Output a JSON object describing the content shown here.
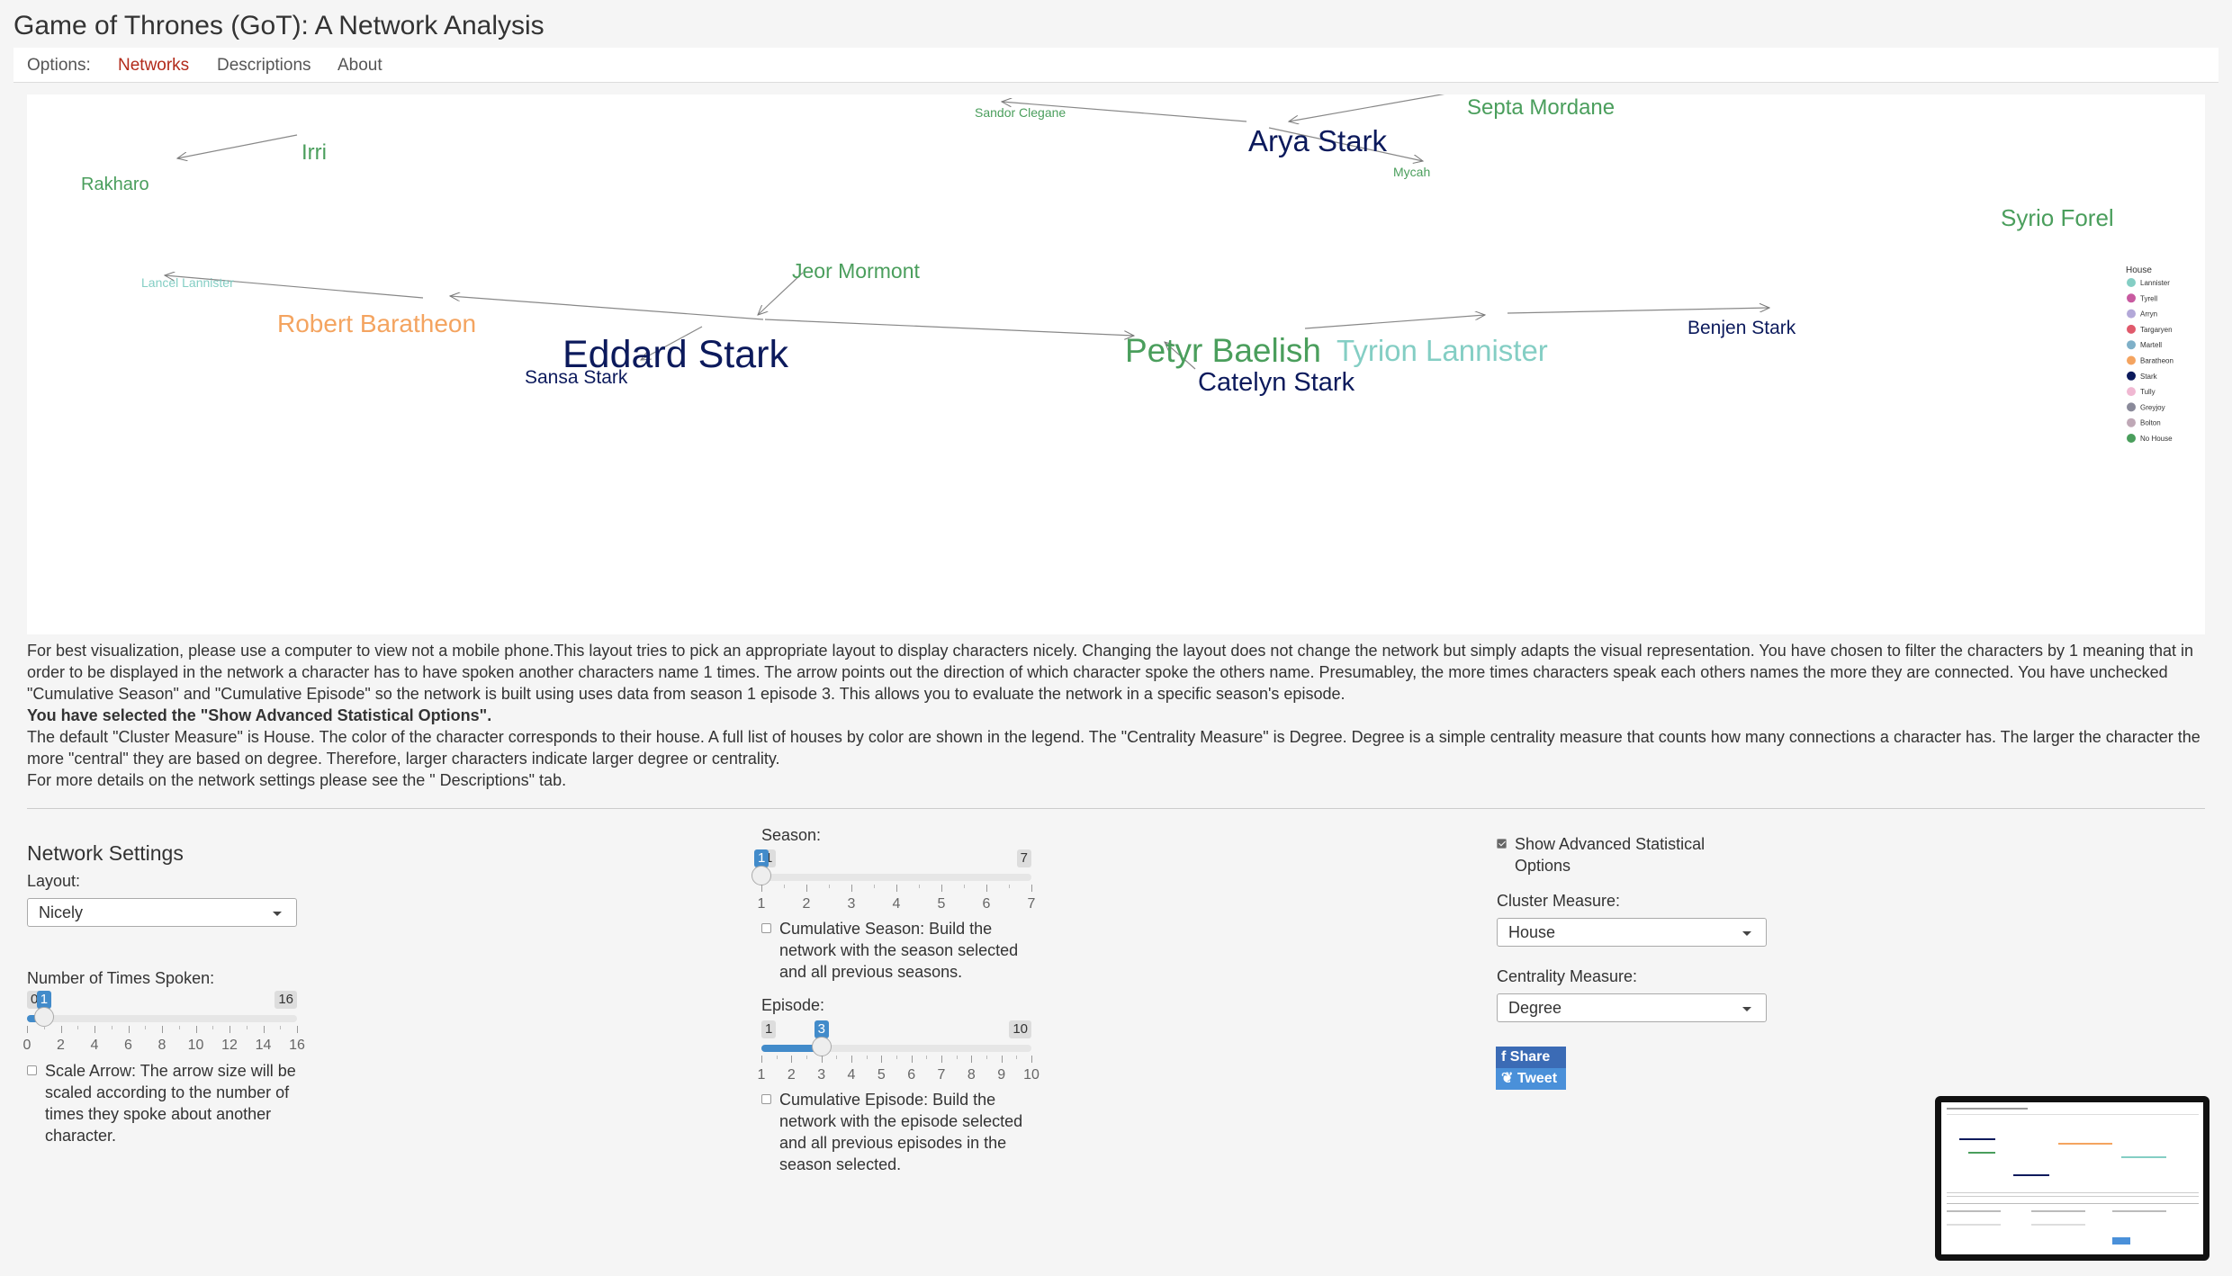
{
  "app": {
    "title": "Game of Thrones (GoT): A Network Analysis"
  },
  "nav": {
    "items": [
      "Options:",
      "Networks",
      "Descriptions",
      "About"
    ],
    "active": "Networks"
  },
  "network": {
    "legend": {
      "title": "House",
      "items": [
        {
          "label": "Lannister",
          "color": "#84cec4"
        },
        {
          "label": "Tyrell",
          "color": "#c85aa0"
        },
        {
          "label": "Arryn",
          "color": "#b3a8d8"
        },
        {
          "label": "Targaryen",
          "color": "#e05a6c"
        },
        {
          "label": "Martell",
          "color": "#7fb0c8"
        },
        {
          "label": "Baratheon",
          "color": "#f4a460"
        },
        {
          "label": "Stark",
          "color": "#0c1a5c"
        },
        {
          "label": "Tully",
          "color": "#f0b8d2"
        },
        {
          "label": "Greyjoy",
          "color": "#8a8a9a"
        },
        {
          "label": "Bolton",
          "color": "#bfa8b6"
        },
        {
          "label": "No House",
          "color": "#4a9e5c"
        }
      ]
    },
    "nodes": [
      {
        "id": "irri",
        "label": "Irri",
        "house": "No House",
        "color": "#4a9e5c"
      },
      {
        "id": "rakharo",
        "label": "Rakharo",
        "house": "No House",
        "color": "#4a9e5c"
      },
      {
        "id": "sandor",
        "label": "Sandor Clegane",
        "house": "No House",
        "color": "#4a9e5c"
      },
      {
        "id": "arya",
        "label": "Arya Stark",
        "house": "Stark",
        "color": "#0c1a5c"
      },
      {
        "id": "septa",
        "label": "Septa Mordane",
        "house": "No House",
        "color": "#4a9e5c"
      },
      {
        "id": "mycah",
        "label": "Mycah",
        "house": "No House",
        "color": "#4a9e5c"
      },
      {
        "id": "syrio",
        "label": "Syrio Forel",
        "house": "No House",
        "color": "#4a9e5c"
      },
      {
        "id": "lancel",
        "label": "Lancel Lannister",
        "house": "Lannister",
        "color": "#84cec4"
      },
      {
        "id": "jeor",
        "label": "Jeor Mormont",
        "house": "No House",
        "color": "#4a9e5c"
      },
      {
        "id": "robert",
        "label": "Robert Baratheon",
        "house": "Baratheon",
        "color": "#f4a460"
      },
      {
        "id": "eddard",
        "label": "Eddard Stark",
        "house": "Stark",
        "color": "#0c1a5c"
      },
      {
        "id": "sansa",
        "label": "Sansa Stark",
        "house": "Stark",
        "color": "#0c1a5c"
      },
      {
        "id": "petyr",
        "label": "Petyr Baelish",
        "house": "No House",
        "color": "#4a9e5c"
      },
      {
        "id": "tyrion",
        "label": "Tyrion Lannister",
        "house": "Lannister",
        "color": "#84cec4"
      },
      {
        "id": "benjen",
        "label": "Benjen Stark",
        "house": "Stark",
        "color": "#0c1a5c"
      },
      {
        "id": "catelyn",
        "label": "Catelyn Stark",
        "house": "Stark",
        "color": "#0c1a5c"
      }
    ],
    "edges": [
      {
        "from": "irri",
        "to": "rakharo"
      },
      {
        "from": "arya",
        "to": "sandor"
      },
      {
        "from": "septa",
        "to": "arya"
      },
      {
        "from": "arya",
        "to": "mycah"
      },
      {
        "from": "robert",
        "to": "lancel"
      },
      {
        "from": "jeor",
        "to": "eddard"
      },
      {
        "from": "eddard",
        "to": "robert"
      },
      {
        "from": "eddard",
        "to": "sansa"
      },
      {
        "from": "eddard",
        "to": "petyr"
      },
      {
        "from": "catelyn",
        "to": "petyr"
      },
      {
        "from": "petyr",
        "to": "tyrion"
      },
      {
        "from": "tyrion",
        "to": "benjen"
      }
    ]
  },
  "description": {
    "p1": "For best visualization, please use a computer to view not a mobile phone.This layout tries to pick an appropriate layout to display characters nicely. Changing the layout does not change the network but simply adapts the visual representation. You have chosen to filter the characters by 1 meaning that in order to be displayed in the network a character has to have spoken another characters name 1 times. The arrow points out the direction of which character spoke the others name. Presumabley, the more times characters speak each others names the more they are connected. You have unchecked \"Cumulative Season\" and \"Cumulative Episode\" so the network is built using uses data from season 1 episode 3. This allows you to evaluate the network in a specific season's episode.",
    "p2": "You have selected the \"Show Advanced Statistical Options\".",
    "p3": "The default \"Cluster Measure\" is House. The color of the character corresponds to their house. A full list of houses by color are shown in the legend. The \"Centrality Measure\" is Degree. Degree is a simple centrality measure that counts how many connections a character has. The larger the character the more \"central\" they are based on degree. Therefore, larger characters indicate larger degree or centrality.",
    "p4": "For more details on the network settings please see the \" Descriptions\" tab."
  },
  "settings": {
    "title": "Network Settings",
    "layout": {
      "label": "Layout:",
      "value": "Nicely"
    },
    "times_spoken": {
      "label": "Number of Times Spoken:",
      "min": 0,
      "max": 16,
      "value": 1,
      "ticks": [
        "0",
        "2",
        "4",
        "6",
        "8",
        "10",
        "12",
        "14",
        "16"
      ],
      "min_label": "0",
      "max_label": "16",
      "value_label": "1"
    },
    "scale_arrow": {
      "checked": false,
      "text": "Scale Arrow: The arrow size will be scaled according to the number of times they spoke about another character."
    },
    "season": {
      "label": "Season:",
      "min": 1,
      "max": 7,
      "value": 1,
      "ticks": [
        "1",
        "2",
        "3",
        "4",
        "5",
        "6",
        "7"
      ],
      "min_label": "1",
      "max_label": "7",
      "value_label": "1"
    },
    "cumulative_season": {
      "checked": false,
      "text": "Cumulative Season: Build the network with the season selected and all previous seasons."
    },
    "episode": {
      "label": "Episode:",
      "min": 1,
      "max": 10,
      "value": 3,
      "ticks": [
        "1",
        "2",
        "3",
        "4",
        "5",
        "6",
        "7",
        "8",
        "9",
        "10"
      ],
      "min_label": "1",
      "max_label": "10",
      "value_label": "3"
    },
    "cumulative_episode": {
      "checked": false,
      "text": "Cumulative Episode: Build the network with the episode selected and all previous episodes in the season selected."
    },
    "advanced": {
      "checked": true,
      "text": "Show Advanced Statistical Options"
    },
    "cluster": {
      "label": "Cluster Measure:",
      "value": "House"
    },
    "centrality": {
      "label": "Centrality Measure:",
      "value": "Degree"
    }
  },
  "social": {
    "share": "Share",
    "tweet": "Tweet"
  }
}
